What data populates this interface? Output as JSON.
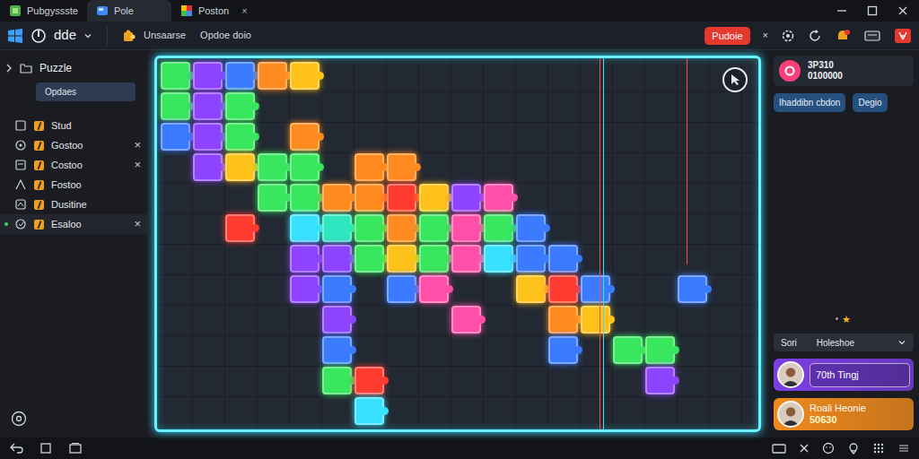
{
  "window": {
    "tabs": [
      {
        "label": "Pubgyssste",
        "selected": false,
        "closable": false
      },
      {
        "label": "Pole",
        "selected": true,
        "closable": false
      },
      {
        "label": "Poston",
        "selected": false,
        "closable": true
      }
    ],
    "close_glyph": "×"
  },
  "toolbar": {
    "app": "dde",
    "title": "Unsaarse",
    "subtitle": "Opdoe doio",
    "action": "Pudoie",
    "close": "×"
  },
  "sidebar": {
    "title": "Puzzle",
    "button": "Opdaes",
    "close_glyph": "×",
    "items": [
      {
        "label": "Stud",
        "closable": false,
        "selected": false
      },
      {
        "label": "Gostoo",
        "closable": true,
        "selected": false
      },
      {
        "label": "Costoo",
        "closable": true,
        "selected": false
      },
      {
        "label": "Fostoo",
        "closable": false,
        "selected": false
      },
      {
        "label": "Dusitine",
        "closable": false,
        "selected": false
      },
      {
        "label": "Esaloo",
        "closable": true,
        "selected": true
      }
    ]
  },
  "board": {
    "pieces": [
      {
        "col": 0,
        "row": 0,
        "color": "#39e75f"
      },
      {
        "col": 1,
        "row": 0,
        "color": "#8e44ff"
      },
      {
        "col": 2,
        "row": 0,
        "color": "#3a7bff"
      },
      {
        "col": 3,
        "row": 0,
        "color": "#ff8a1f"
      },
      {
        "col": 4,
        "row": 0,
        "color": "#ffc21a"
      },
      {
        "col": 0,
        "row": 1,
        "color": "#39e75f"
      },
      {
        "col": 1,
        "row": 1,
        "color": "#8e44ff"
      },
      {
        "col": 2,
        "row": 1,
        "color": "#39e75f"
      },
      {
        "col": 0,
        "row": 2,
        "color": "#3a7bff"
      },
      {
        "col": 1,
        "row": 2,
        "color": "#8e44ff"
      },
      {
        "col": 2,
        "row": 2,
        "color": "#39e75f"
      },
      {
        "col": 4,
        "row": 2,
        "color": "#ff8a1f"
      },
      {
        "col": 1,
        "row": 3,
        "color": "#8e44ff"
      },
      {
        "col": 2,
        "row": 3,
        "color": "#ffc21a"
      },
      {
        "col": 3,
        "row": 3,
        "color": "#39e75f"
      },
      {
        "col": 4,
        "row": 3,
        "color": "#39e75f"
      },
      {
        "col": 6,
        "row": 3,
        "color": "#ff8a1f"
      },
      {
        "col": 7,
        "row": 3,
        "color": "#ff8a1f"
      },
      {
        "col": 3,
        "row": 4,
        "color": "#39e75f"
      },
      {
        "col": 4,
        "row": 4,
        "color": "#39e75f"
      },
      {
        "col": 5,
        "row": 4,
        "color": "#ff8a1f"
      },
      {
        "col": 6,
        "row": 4,
        "color": "#ff8a1f"
      },
      {
        "col": 7,
        "row": 4,
        "color": "#ff3b2f"
      },
      {
        "col": 8,
        "row": 4,
        "color": "#ffc21a"
      },
      {
        "col": 9,
        "row": 4,
        "color": "#8e44ff"
      },
      {
        "col": 10,
        "row": 4,
        "color": "#ff4fa8"
      },
      {
        "col": 2,
        "row": 5,
        "color": "#ff3b2f"
      },
      {
        "col": 4,
        "row": 5,
        "color": "#38e1ff"
      },
      {
        "col": 5,
        "row": 5,
        "color": "#2ee6c0"
      },
      {
        "col": 6,
        "row": 5,
        "color": "#39e75f"
      },
      {
        "col": 7,
        "row": 5,
        "color": "#ff8a1f"
      },
      {
        "col": 8,
        "row": 5,
        "color": "#39e75f"
      },
      {
        "col": 9,
        "row": 5,
        "color": "#ff4fa8"
      },
      {
        "col": 10,
        "row": 5,
        "color": "#39e75f"
      },
      {
        "col": 11,
        "row": 5,
        "color": "#3a7bff"
      },
      {
        "col": 4,
        "row": 6,
        "color": "#8e44ff"
      },
      {
        "col": 5,
        "row": 6,
        "color": "#8e44ff"
      },
      {
        "col": 6,
        "row": 6,
        "color": "#39e75f"
      },
      {
        "col": 7,
        "row": 6,
        "color": "#ffc21a"
      },
      {
        "col": 8,
        "row": 6,
        "color": "#39e75f"
      },
      {
        "col": 9,
        "row": 6,
        "color": "#ff4fa8"
      },
      {
        "col": 10,
        "row": 6,
        "color": "#38e1ff"
      },
      {
        "col": 11,
        "row": 6,
        "color": "#3a7bff"
      },
      {
        "col": 12,
        "row": 6,
        "color": "#3a7bff"
      },
      {
        "col": 4,
        "row": 7,
        "color": "#8e44ff"
      },
      {
        "col": 5,
        "row": 7,
        "color": "#3a7bff"
      },
      {
        "col": 7,
        "row": 7,
        "color": "#3a7bff"
      },
      {
        "col": 8,
        "row": 7,
        "color": "#ff4fa8"
      },
      {
        "col": 11,
        "row": 7,
        "color": "#ffc21a"
      },
      {
        "col": 12,
        "row": 7,
        "color": "#ff3b2f"
      },
      {
        "col": 13,
        "row": 7,
        "color": "#3a7bff"
      },
      {
        "col": 16,
        "row": 7,
        "color": "#3a7bff"
      },
      {
        "col": 5,
        "row": 8,
        "color": "#8e44ff"
      },
      {
        "col": 9,
        "row": 8,
        "color": "#ff4fa8"
      },
      {
        "col": 12,
        "row": 8,
        "color": "#ff8a1f"
      },
      {
        "col": 13,
        "row": 8,
        "color": "#ffc21a"
      },
      {
        "col": 5,
        "row": 9,
        "color": "#3a7bff"
      },
      {
        "col": 12,
        "row": 9,
        "color": "#3a7bff"
      },
      {
        "col": 14,
        "row": 9,
        "color": "#39e75f"
      },
      {
        "col": 15,
        "row": 9,
        "color": "#39e75f"
      },
      {
        "col": 5,
        "row": 10,
        "color": "#39e75f"
      },
      {
        "col": 6,
        "row": 10,
        "color": "#ff3b2f"
      },
      {
        "col": 15,
        "row": 10,
        "color": "#8e44ff"
      },
      {
        "col": 6,
        "row": 11,
        "color": "#38e1ff"
      }
    ]
  },
  "right_panel": {
    "profile": {
      "line1": "3P310",
      "line2": "0100000"
    },
    "buttons": [
      "Ihaddibn cbdon",
      "Degio"
    ],
    "star": "★",
    "filter": {
      "label": "Sori",
      "value": "Holeshoe"
    },
    "players": [
      {
        "name": "70th Tingj",
        "color": "#7b3fe4"
      },
      {
        "name": "Roali Heonie",
        "score": "50630",
        "color": "#f08a1c"
      }
    ]
  }
}
